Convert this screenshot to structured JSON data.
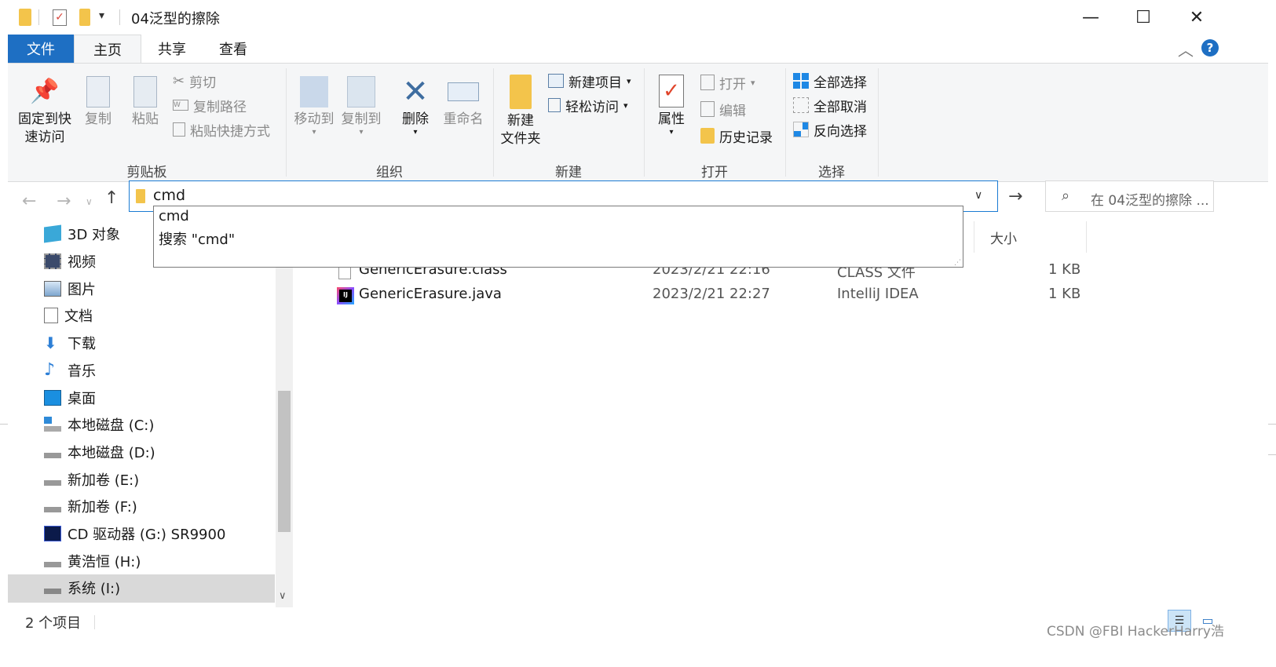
{
  "window": {
    "title": "04泛型的擦除",
    "minimize_label": "—",
    "maximize_label": "☐",
    "close_label": "✕"
  },
  "tabs": [
    {
      "label": "文件"
    },
    {
      "label": "主页"
    },
    {
      "label": "共享"
    },
    {
      "label": "查看"
    }
  ],
  "ribbon": {
    "clipboard": {
      "pin_label_1": "固定到快",
      "pin_label_2": "速访问",
      "copy_label": "复制",
      "paste_label": "粘贴",
      "cut_label": "剪切",
      "copy_path_label": "复制路径",
      "paste_shortcut_label": "粘贴快捷方式",
      "group_label": "剪贴板"
    },
    "organize": {
      "move_to_label": "移动到",
      "copy_to_label": "复制到",
      "delete_label": "删除",
      "rename_label": "重命名",
      "group_label": "组织"
    },
    "new": {
      "new_folder_label_1": "新建",
      "new_folder_label_2": "文件夹",
      "new_item_label": "新建项目",
      "easy_access_label": "轻松访问",
      "group_label": "新建"
    },
    "open": {
      "properties_label": "属性",
      "open_label": "打开",
      "edit_label": "编辑",
      "history_label": "历史记录",
      "group_label": "打开"
    },
    "select": {
      "select_all_label": "全部选择",
      "select_none_label": "全部取消",
      "invert_label": "反向选择",
      "group_label": "选择"
    }
  },
  "address": {
    "value": "cmd",
    "suggestions": [
      "cmd",
      "搜索 \"cmd\""
    ]
  },
  "search": {
    "placeholder": "在 04泛型的擦除 ..."
  },
  "sidebar": {
    "items": [
      {
        "label": "3D 对象"
      },
      {
        "label": "视频"
      },
      {
        "label": "图片"
      },
      {
        "label": "文档"
      },
      {
        "label": "下载"
      },
      {
        "label": "音乐"
      },
      {
        "label": "桌面"
      },
      {
        "label": "本地磁盘 (C:)"
      },
      {
        "label": "本地磁盘 (D:)"
      },
      {
        "label": "新加卷 (E:)"
      },
      {
        "label": "新加卷 (F:)"
      },
      {
        "label": "CD 驱动器 (G:) SR9900"
      },
      {
        "label": "黄浩恒 (H:)"
      },
      {
        "label": "系统 (I:)"
      }
    ]
  },
  "filelist": {
    "size_header": "大小",
    "files": [
      {
        "name": "GenericErasure.class",
        "date": "2023/2/21 22:16",
        "type": "CLASS 文件",
        "size": "1 KB"
      },
      {
        "name": "GenericErasure.java",
        "date": "2023/2/21 22:27",
        "type": "IntelliJ IDEA",
        "size": "1 KB"
      }
    ]
  },
  "status": {
    "count": "2 个项目"
  },
  "watermark": "CSDN @FBI HackerHarry浩",
  "colors": {
    "accent": "#1e6fc3",
    "ribbon_bg": "#f5f6f7",
    "address_border": "#1b7bd3",
    "selected_nav": "#d9d9d9"
  }
}
